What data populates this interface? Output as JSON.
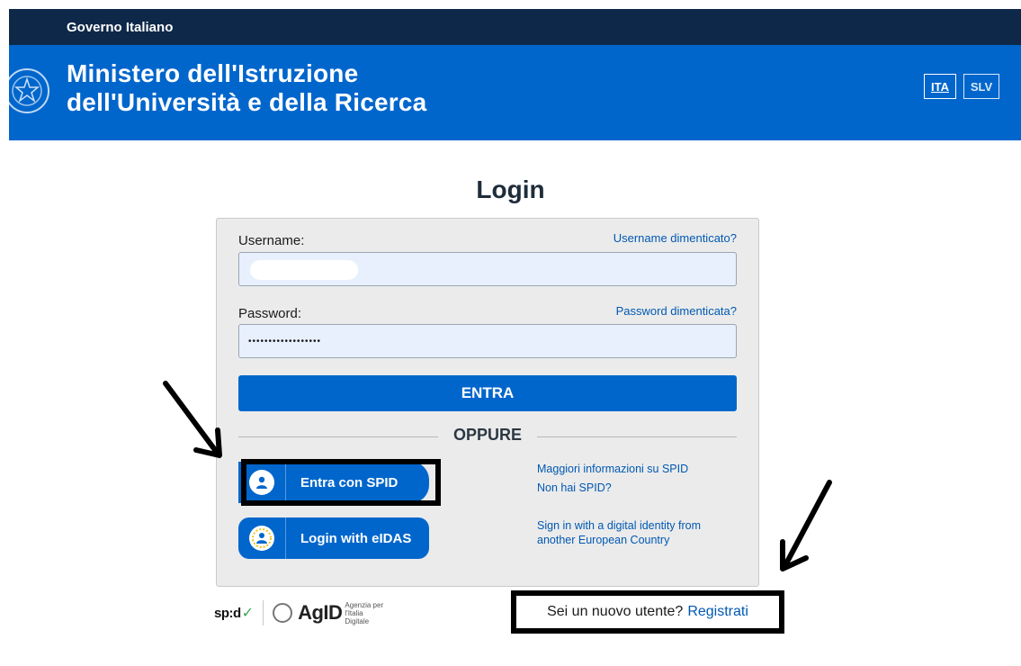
{
  "gov_bar": {
    "label": "Governo Italiano"
  },
  "header": {
    "title_line1": "Ministero dell'Istruzione",
    "title_line2": "dell'Università e della Ricerca",
    "languages": [
      "ITA",
      "SLV"
    ],
    "active_language": "ITA"
  },
  "page_title": "Login",
  "form": {
    "username_label": "Username:",
    "username_value": "",
    "forgot_username": "Username dimenticato?",
    "password_label": "Password:",
    "password_value": "••••••••••••••••••",
    "forgot_password": "Password dimenticata?",
    "submit_label": "ENTRA",
    "divider_label": "OPPURE"
  },
  "alt_login": {
    "spid_button": "Entra con SPID",
    "spid_info": "Maggiori informazioni su SPID",
    "spid_missing": "Non hai SPID?",
    "eidas_button": "Login with eIDAS",
    "eidas_info_line1": "Sign in with a digital identity from",
    "eidas_info_line2": "another European Country"
  },
  "footer": {
    "spid_logo": "sp:d",
    "agid_logo": "AgID",
    "agid_subtitle": "Agenzia per l'Italia Digitale",
    "register_question": "Sei un nuovo utente?",
    "register_link": "Registrati"
  },
  "colors": {
    "gov_bar": "#0d2849",
    "header": "#0066cc",
    "link": "#0059b3",
    "card": "#ebebeb",
    "input_bg": "#e8f0fe"
  }
}
